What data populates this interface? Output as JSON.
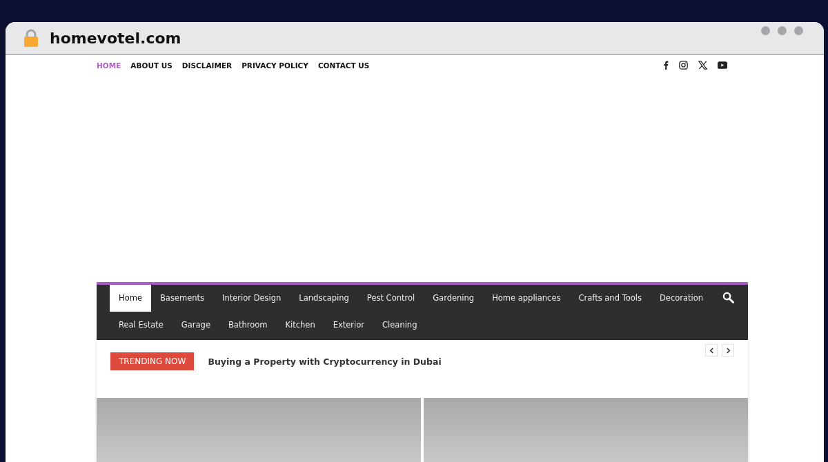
{
  "browser": {
    "address": "homevotel.com"
  },
  "top_menu": [
    {
      "label": "HOME",
      "selected": true
    },
    {
      "label": "ABOUT US",
      "selected": false
    },
    {
      "label": "DISCLAIMER",
      "selected": false
    },
    {
      "label": "PRIVACY POLICY",
      "selected": false
    },
    {
      "label": "CONTACT US",
      "selected": false
    }
  ],
  "social": [
    {
      "kind": "facebook"
    },
    {
      "kind": "instagram"
    },
    {
      "kind": "x"
    },
    {
      "kind": "youtube"
    }
  ],
  "main_nav": [
    {
      "label": "Home",
      "selected": true
    },
    {
      "label": "Basements",
      "selected": false
    },
    {
      "label": "Interior Design",
      "selected": false
    },
    {
      "label": "Landscaping",
      "selected": false
    },
    {
      "label": "Pest Control",
      "selected": false
    },
    {
      "label": "Gardening",
      "selected": false
    },
    {
      "label": "Home appliances",
      "selected": false
    },
    {
      "label": "Crafts and Tools",
      "selected": false
    },
    {
      "label": "Decoration",
      "selected": false
    },
    {
      "label": "Real Estate",
      "selected": false
    },
    {
      "label": "Garage",
      "selected": false
    },
    {
      "label": "Bathroom",
      "selected": false
    },
    {
      "label": "Kitchen",
      "selected": false
    },
    {
      "label": "Exterior",
      "selected": false
    },
    {
      "label": "Cleaning",
      "selected": false
    }
  ],
  "trending": {
    "badge": "TRENDING NOW",
    "headline": "Buying a Property with Cryptocurrency in Dubai"
  }
}
